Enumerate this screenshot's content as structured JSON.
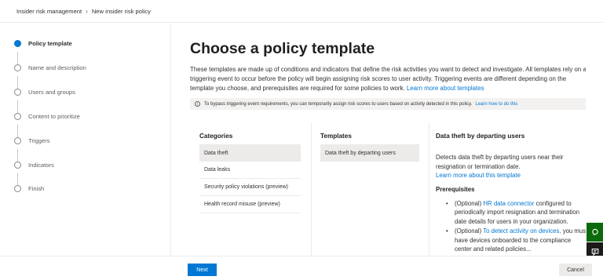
{
  "breadcrumb": {
    "root": "Insider risk management",
    "current": "New insider risk policy"
  },
  "steps": [
    {
      "label": "Policy template",
      "active": true
    },
    {
      "label": "Name and description",
      "active": false
    },
    {
      "label": "Users and groups",
      "active": false
    },
    {
      "label": "Content to prioritize",
      "active": false
    },
    {
      "label": "Triggers",
      "active": false
    },
    {
      "label": "Indicators",
      "active": false
    },
    {
      "label": "Finish",
      "active": false
    }
  ],
  "main": {
    "title": "Choose a policy template",
    "description": "These templates are made up of conditions and indicators that define the risk activities you want to detect and investigate. All templates rely on a triggering event to occur before the policy will begin assigning risk scores to user activity. Triggering events are different depending on the template you choose, and prerequisites are required for some policies to work.",
    "description_link": "Learn more about templates",
    "notice": "To bypass triggering event requirements, you can temporarily assign risk scores to users based on activity detected in this policy.",
    "notice_link": "Learn how to do this"
  },
  "categories": {
    "header": "Categories",
    "items": [
      "Data theft",
      "Data leaks",
      "Security policy violations (preview)",
      "Health record misuse (preview)"
    ]
  },
  "templates": {
    "header": "Templates",
    "items": [
      "Data theft by departing users"
    ]
  },
  "detail": {
    "title": "Data theft by departing users",
    "description": "Detects data theft by departing users near their resignation or termination date.",
    "learn_more": "Learn more about this template",
    "prereq_header": "Prerequisites",
    "prereq1_a": "(Optional)",
    "prereq1_link": "HR data connector",
    "prereq1_b": "configured to periodically import resignation and termination date details for users in your organization.",
    "prereq2_a": "(Optional)",
    "prereq2_link": "To detect activity on devices,",
    "prereq2_b": "you must have devices onboarded to the compliance center and related policies..."
  },
  "footer": {
    "next": "Next",
    "cancel": "Cancel"
  },
  "colors": {
    "accent": "#0078d4",
    "selected_bg": "#edebe9",
    "help_button": "#0b6a0b"
  },
  "icons": [
    "chevron-right-icon",
    "info-icon",
    "help-icon",
    "feedback-icon"
  ]
}
